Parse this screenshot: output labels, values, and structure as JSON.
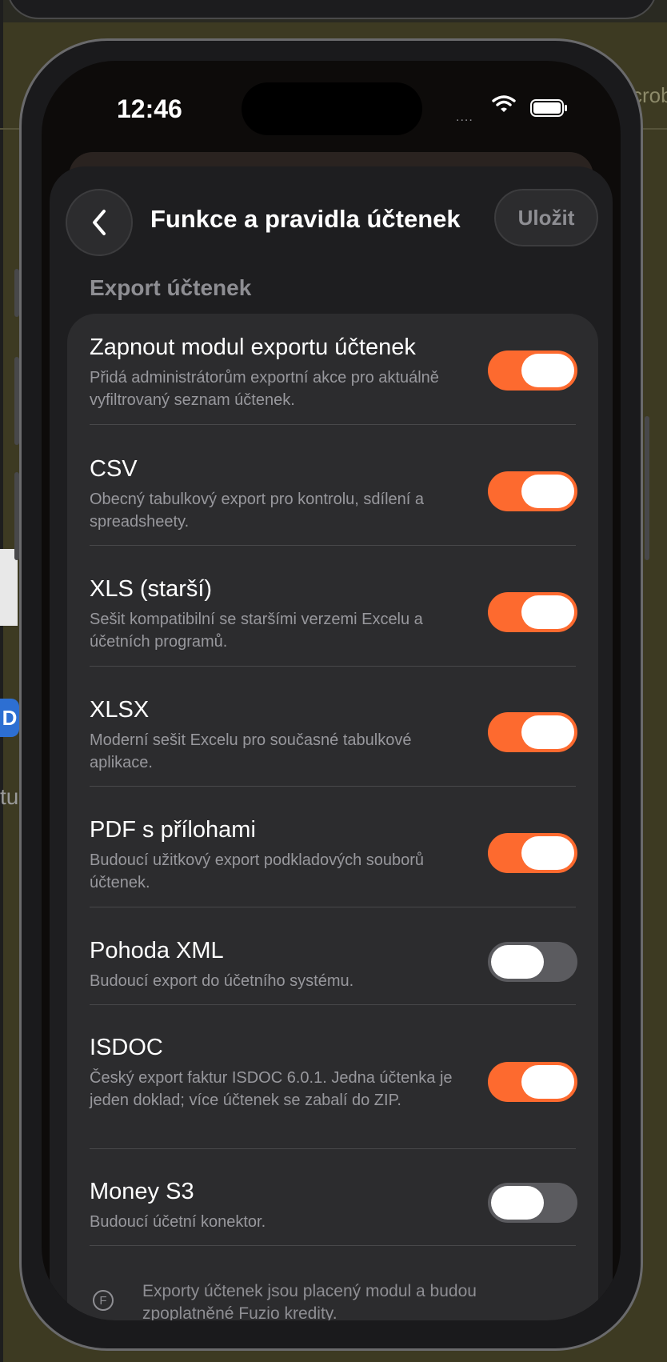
{
  "background": {
    "left_badge": "D",
    "left_text": "tu",
    "right_text": "crob"
  },
  "status_bar": {
    "time": "12:46",
    "signal": "....",
    "icons": [
      "wifi-icon",
      "battery-icon"
    ]
  },
  "nav": {
    "back_icon": "chevron-left-icon",
    "title": "Funkce a pravidla účtenek",
    "save_label": "Uložit"
  },
  "section": {
    "title": "Export účtenek"
  },
  "options": [
    {
      "title": "Zapnout modul exportu účtenek",
      "description": "Přidá administrátorům exportní akce pro aktuálně vyfiltrovaný seznam účtenek.",
      "enabled": true
    },
    {
      "title": "CSV",
      "description": "Obecný tabulkový export pro kontrolu, sdílení a spreadsheety.",
      "enabled": true
    },
    {
      "title": "XLS (starší)",
      "description": "Sešit kompatibilní se staršími verzemi Excelu a účetních programů.",
      "enabled": true
    },
    {
      "title": "XLSX",
      "description": "Moderní sešit Excelu pro současné tabulkové aplikace.",
      "enabled": true
    },
    {
      "title": "PDF s přílohami",
      "description": "Budoucí užitkový export podkladových souborů účtenek.",
      "enabled": true
    },
    {
      "title": "Pohoda XML",
      "description": "Budoucí export do účetního systému.",
      "enabled": false
    },
    {
      "title": "ISDOC",
      "description": "Český export faktur ISDOC 6.0.1. Jedna účtenka je jeden doklad; více účtenek se zabalí do ZIP.",
      "enabled": true
    },
    {
      "title": "Money S3",
      "description": "Budoucí účetní konektor.",
      "enabled": false
    }
  ],
  "footer": {
    "icon_letter": "F",
    "text": "Exporty účtenek jsou placený modul a budou zpoplatněné Fuzio kredity."
  },
  "colors": {
    "accent": "#fd6a2f",
    "toggle_off": "#5b5b5f",
    "card": "#2c2c2e",
    "sheet": "#1e1e20"
  }
}
